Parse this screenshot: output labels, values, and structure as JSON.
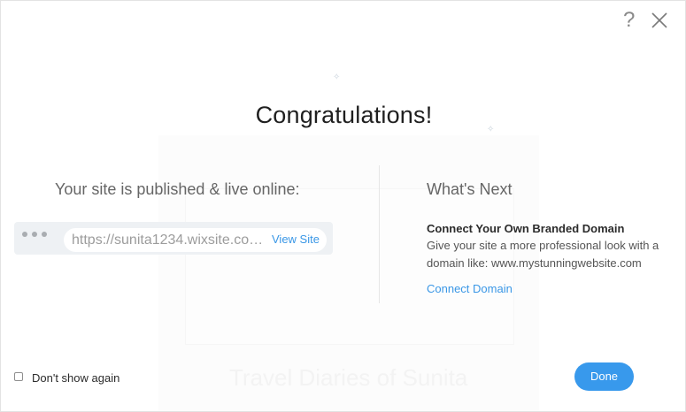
{
  "dialog": {
    "title": "Congratulations!",
    "help_symbol": "?"
  },
  "published": {
    "heading": "Your site is published & live online:",
    "site_url": "https://sunita1234.wixsite.com/travel",
    "view_site_label": "View Site"
  },
  "whats_next": {
    "heading": "What's Next",
    "domain_title": "Connect Your Own Branded Domain",
    "domain_description": "Give your site a more professional look with a domain like: www.mystunningwebsite.com",
    "connect_link": "Connect Domain"
  },
  "footer": {
    "dont_show_label": "Don't show again",
    "dont_show_checked": false,
    "done_label": "Done"
  },
  "background": {
    "ghost_text": "Travel Diaries of Sunita"
  },
  "colors": {
    "accent": "#3899ec",
    "link": "#3a97e6",
    "heading_gray": "#666666"
  }
}
